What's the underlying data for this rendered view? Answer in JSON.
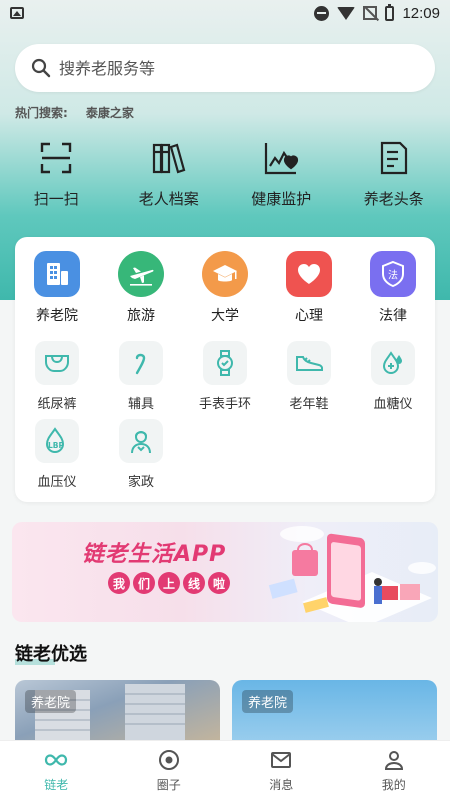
{
  "status": {
    "time": "12:09"
  },
  "search": {
    "placeholder": "搜养老服务等"
  },
  "hot": {
    "label": "热门搜索:",
    "tags": [
      "泰康之家"
    ]
  },
  "quick_actions": [
    {
      "label": "扫一扫",
      "icon": "scan-icon"
    },
    {
      "label": "老人档案",
      "icon": "archive-books-icon"
    },
    {
      "label": "健康监护",
      "icon": "health-monitor-icon"
    },
    {
      "label": "养老头条",
      "icon": "news-doc-icon"
    }
  ],
  "categories": [
    {
      "label": "养老院",
      "icon": "building-icon",
      "color": "#4a90e2"
    },
    {
      "label": "旅游",
      "icon": "airplane-icon",
      "color": "#37b779"
    },
    {
      "label": "大学",
      "icon": "graduation-cap-icon",
      "color": "#f39a4a"
    },
    {
      "label": "心理",
      "icon": "heart-icon",
      "color": "#ef5350"
    },
    {
      "label": "法律",
      "icon": "law-shield-icon",
      "color": "#7a6ff0",
      "glyph": "法"
    }
  ],
  "products": [
    {
      "label": "纸尿裤",
      "icon": "diaper-icon"
    },
    {
      "label": "辅具",
      "icon": "cane-icon"
    },
    {
      "label": "手表手环",
      "icon": "watch-icon"
    },
    {
      "label": "老年鞋",
      "icon": "shoe-icon"
    },
    {
      "label": "血糖仪",
      "icon": "glucose-drop-icon"
    },
    {
      "label": "血压仪",
      "icon": "blood-pressure-icon",
      "glyph": "LBP"
    },
    {
      "label": "家政",
      "icon": "housekeeper-icon"
    }
  ],
  "banner": {
    "title": "链老生活APP",
    "slogan": [
      "我",
      "们",
      "上",
      "线",
      "啦"
    ]
  },
  "section": {
    "title": "链老优选"
  },
  "picks": [
    {
      "tag": "养老院"
    },
    {
      "tag": "养老院"
    }
  ],
  "tabs": [
    {
      "label": "链老",
      "icon": "infinity-icon",
      "active": true
    },
    {
      "label": "圈子",
      "icon": "circle-dot-icon",
      "active": false
    },
    {
      "label": "消息",
      "icon": "mail-icon",
      "active": false
    },
    {
      "label": "我的",
      "icon": "person-icon",
      "active": false
    }
  ],
  "colors": {
    "accent": "#3fb8ac",
    "banner_red": "#e23a73"
  }
}
